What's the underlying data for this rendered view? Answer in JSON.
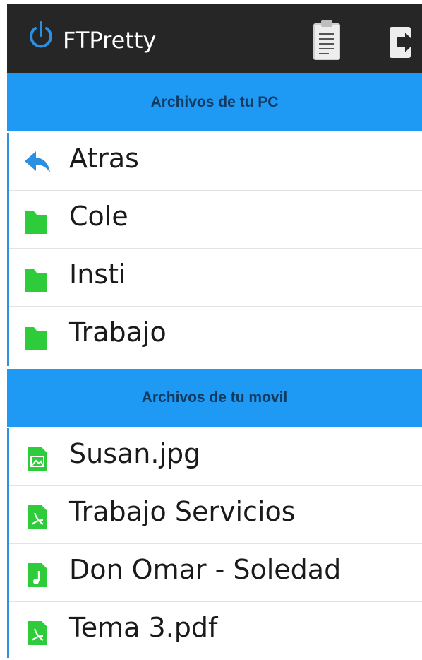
{
  "app": {
    "title": "FTPretty"
  },
  "toolbar": {
    "clipboard_icon": "clipboard-icon",
    "exit_icon": "exit-icon"
  },
  "pc_section": {
    "header": "Archivos de tu PC",
    "items": [
      {
        "label": "Atras",
        "icon": "back-arrow-icon"
      },
      {
        "label": "Cole",
        "icon": "folder-icon"
      },
      {
        "label": "Insti",
        "icon": "folder-icon"
      },
      {
        "label": "Trabajo",
        "icon": "folder-icon"
      }
    ]
  },
  "mobile_section": {
    "header": "Archivos de tu movil",
    "items": [
      {
        "label": "Susan.jpg",
        "icon": "image-file-icon"
      },
      {
        "label": "Trabajo Servicios",
        "icon": "pdf-file-icon"
      },
      {
        "label": "Don Omar - Soledad",
        "icon": "music-file-icon"
      },
      {
        "label": "Tema 3.pdf",
        "icon": "pdf-file-icon"
      }
    ]
  },
  "colors": {
    "appbar": "#262626",
    "accent": "#1e9af5",
    "header_text": "#113a60",
    "file_green": "#2ecc3a"
  }
}
